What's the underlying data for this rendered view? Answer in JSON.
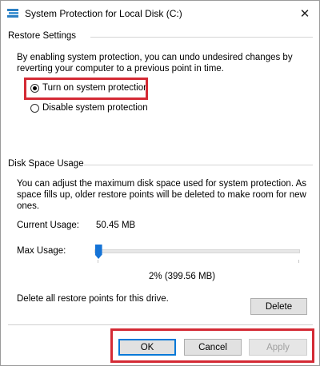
{
  "window": {
    "title": "System Protection for Local Disk (C:)",
    "close_glyph": "✕"
  },
  "restore_settings": {
    "heading": "Restore Settings",
    "description_line1": "By enabling system protection, you can undo undesired changes by",
    "description_line2": "reverting your computer to a previous point in time.",
    "options": [
      {
        "label": "Turn on system protection",
        "selected": true
      },
      {
        "label": "Disable system protection",
        "selected": false
      }
    ]
  },
  "disk_space": {
    "heading": "Disk Space Usage",
    "description_line1": "You can adjust the maximum disk space used for system protection. As",
    "description_line2": "space fills up, older restore points will be deleted to make room for new",
    "description_line3": "ones.",
    "current_usage_label": "Current Usage:",
    "current_usage_value": "50.45 MB",
    "max_usage_label": "Max Usage:",
    "max_usage_percent": 2,
    "max_usage_text": "2% (399.56 MB)",
    "delete_text": "Delete all restore points for this drive.",
    "delete_button": "Delete"
  },
  "footer": {
    "ok": "OK",
    "cancel": "Cancel",
    "apply": "Apply"
  },
  "colors": {
    "highlight": "#d42a35",
    "slider_thumb": "#1573d6",
    "focus": "#0078d7"
  }
}
